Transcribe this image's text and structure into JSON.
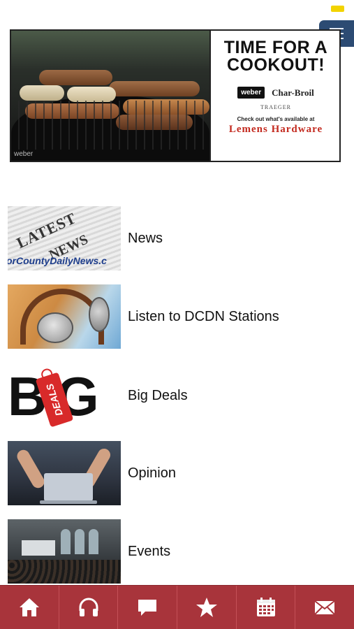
{
  "banner_ad": {
    "headline_line1": "TIME FOR A",
    "headline_line2": "COOKOUT!",
    "brand_weber": "weber",
    "brand_charbroil": "Char-Broil",
    "brand_traeger": "TRAEGER",
    "tagline": "Check out what's available at",
    "store_name": "Lemens Hardware",
    "photo_caption": "weber"
  },
  "menu": {
    "items": [
      {
        "label": "News",
        "thumb_line1": "LATEST",
        "thumb_line2": "NEWS",
        "thumb_line3": "orCountyDailyNews.c"
      },
      {
        "label": "Listen to DCDN Stations"
      },
      {
        "label": "Big Deals",
        "thumb_big": "BIG",
        "thumb_tag": "DEALS"
      },
      {
        "label": "Opinion"
      },
      {
        "label": "Events"
      }
    ]
  },
  "tabbar": {
    "tabs": [
      {
        "icon": "home-icon"
      },
      {
        "icon": "headphones-icon"
      },
      {
        "icon": "chat-icon"
      },
      {
        "icon": "star-icon"
      },
      {
        "icon": "calendar-icon"
      },
      {
        "icon": "mail-icon"
      }
    ]
  },
  "colors": {
    "tabbar_bg": "#a8343b",
    "menu_button_bg": "#2c4b73",
    "status_indicator": "#f2d300"
  }
}
